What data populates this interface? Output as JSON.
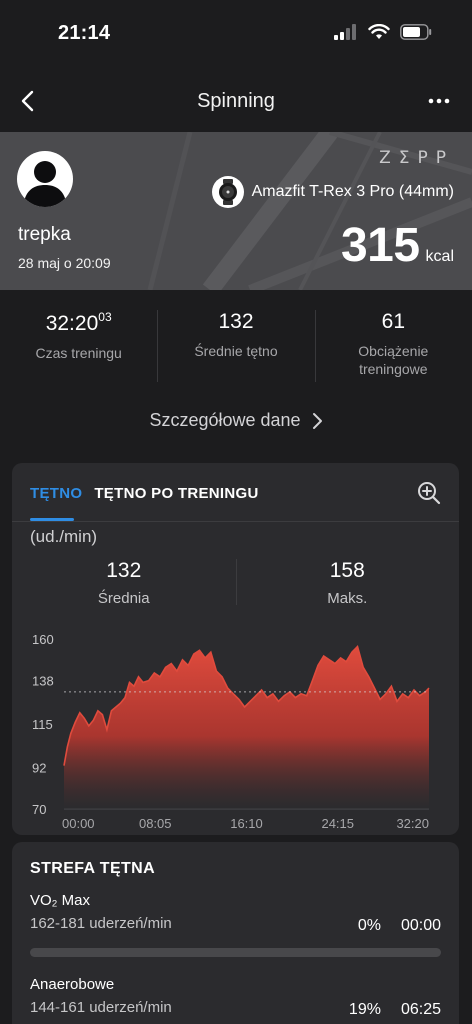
{
  "status_bar": {
    "time": "21:14"
  },
  "nav": {
    "title": "Spinning"
  },
  "hero": {
    "brand": "ZΣPP",
    "device": "Amazfit T-Rex 3 Pro (44mm)",
    "username": "trepka",
    "date": "28 maj o 20:09",
    "calories": "315",
    "calories_unit": "kcal"
  },
  "summary": {
    "duration_main": "32:20",
    "duration_sub": "03",
    "duration_label": "Czas treningu",
    "avg_hr": "132",
    "avg_hr_label": "Średnie tętno",
    "load": "61",
    "load_label": "Obciążenie treningowe"
  },
  "details_link": "Szczegółowe dane",
  "heart_rate": {
    "tabs": [
      "TĘTNO",
      "TĘTNO PO TRENINGU"
    ],
    "active_tab": 0,
    "unit": "(ud./min)",
    "avg_value": "132",
    "avg_label": "Średnia",
    "max_value": "158",
    "max_label": "Maks."
  },
  "chart_data": {
    "type": "area",
    "ylim": [
      70,
      160
    ],
    "y_ticks": [
      160,
      138,
      115,
      92,
      70
    ],
    "x_ticks": [
      "00:00",
      "08:05",
      "16:10",
      "24:15",
      "32:20"
    ],
    "xlim_minutes": [
      0,
      32.33
    ],
    "average_line": 132,
    "series": [
      {
        "color": "#e04b3d",
        "x": [
          0,
          0.3,
          0.6,
          1,
          1.4,
          1.8,
          2.2,
          2.6,
          3,
          3.4,
          3.8,
          4.2,
          4.6,
          5,
          5.4,
          5.8,
          6.2,
          6.6,
          7,
          7.5,
          8,
          8.5,
          9,
          9.5,
          10,
          10.5,
          11,
          11.5,
          12,
          12.5,
          13,
          13.5,
          14,
          14.5,
          15,
          15.5,
          16,
          16.5,
          17,
          17.5,
          18,
          18.5,
          19,
          19.5,
          20,
          20.5,
          21,
          21.5,
          22,
          22.5,
          23,
          23.5,
          24,
          24.5,
          25,
          25.5,
          26,
          26.5,
          27,
          27.5,
          28,
          28.5,
          29,
          29.5,
          30,
          30.5,
          31,
          31.5,
          32,
          32.33
        ],
        "values": [
          93,
          103,
          110,
          116,
          121,
          118,
          114,
          117,
          122,
          120,
          112,
          122,
          124,
          126,
          129,
          137,
          135,
          140,
          137,
          138,
          142,
          140,
          145,
          147,
          143,
          149,
          146,
          152,
          154,
          150,
          153,
          143,
          140,
          134,
          131,
          128,
          124,
          127,
          130,
          133,
          129,
          131,
          127,
          130,
          132,
          129,
          131,
          130,
          138,
          146,
          151,
          149,
          147,
          150,
          148,
          153,
          156,
          145,
          140,
          134,
          128,
          131,
          135,
          127,
          131,
          129,
          133,
          130,
          132,
          134
        ]
      }
    ]
  },
  "zones": {
    "title": "STREFA TĘTNA",
    "items": [
      {
        "name": "VO₂ Max",
        "range": "162-181 uderzeń/min",
        "percent": "0%",
        "time": "00:00",
        "fraction": 0,
        "color": "#e04b3d"
      },
      {
        "name": "Anaerobowe",
        "range": "144-161 uderzeń/min",
        "percent": "19%",
        "time": "06:25",
        "fraction": 0.19,
        "color": "#f08a3a"
      }
    ]
  }
}
